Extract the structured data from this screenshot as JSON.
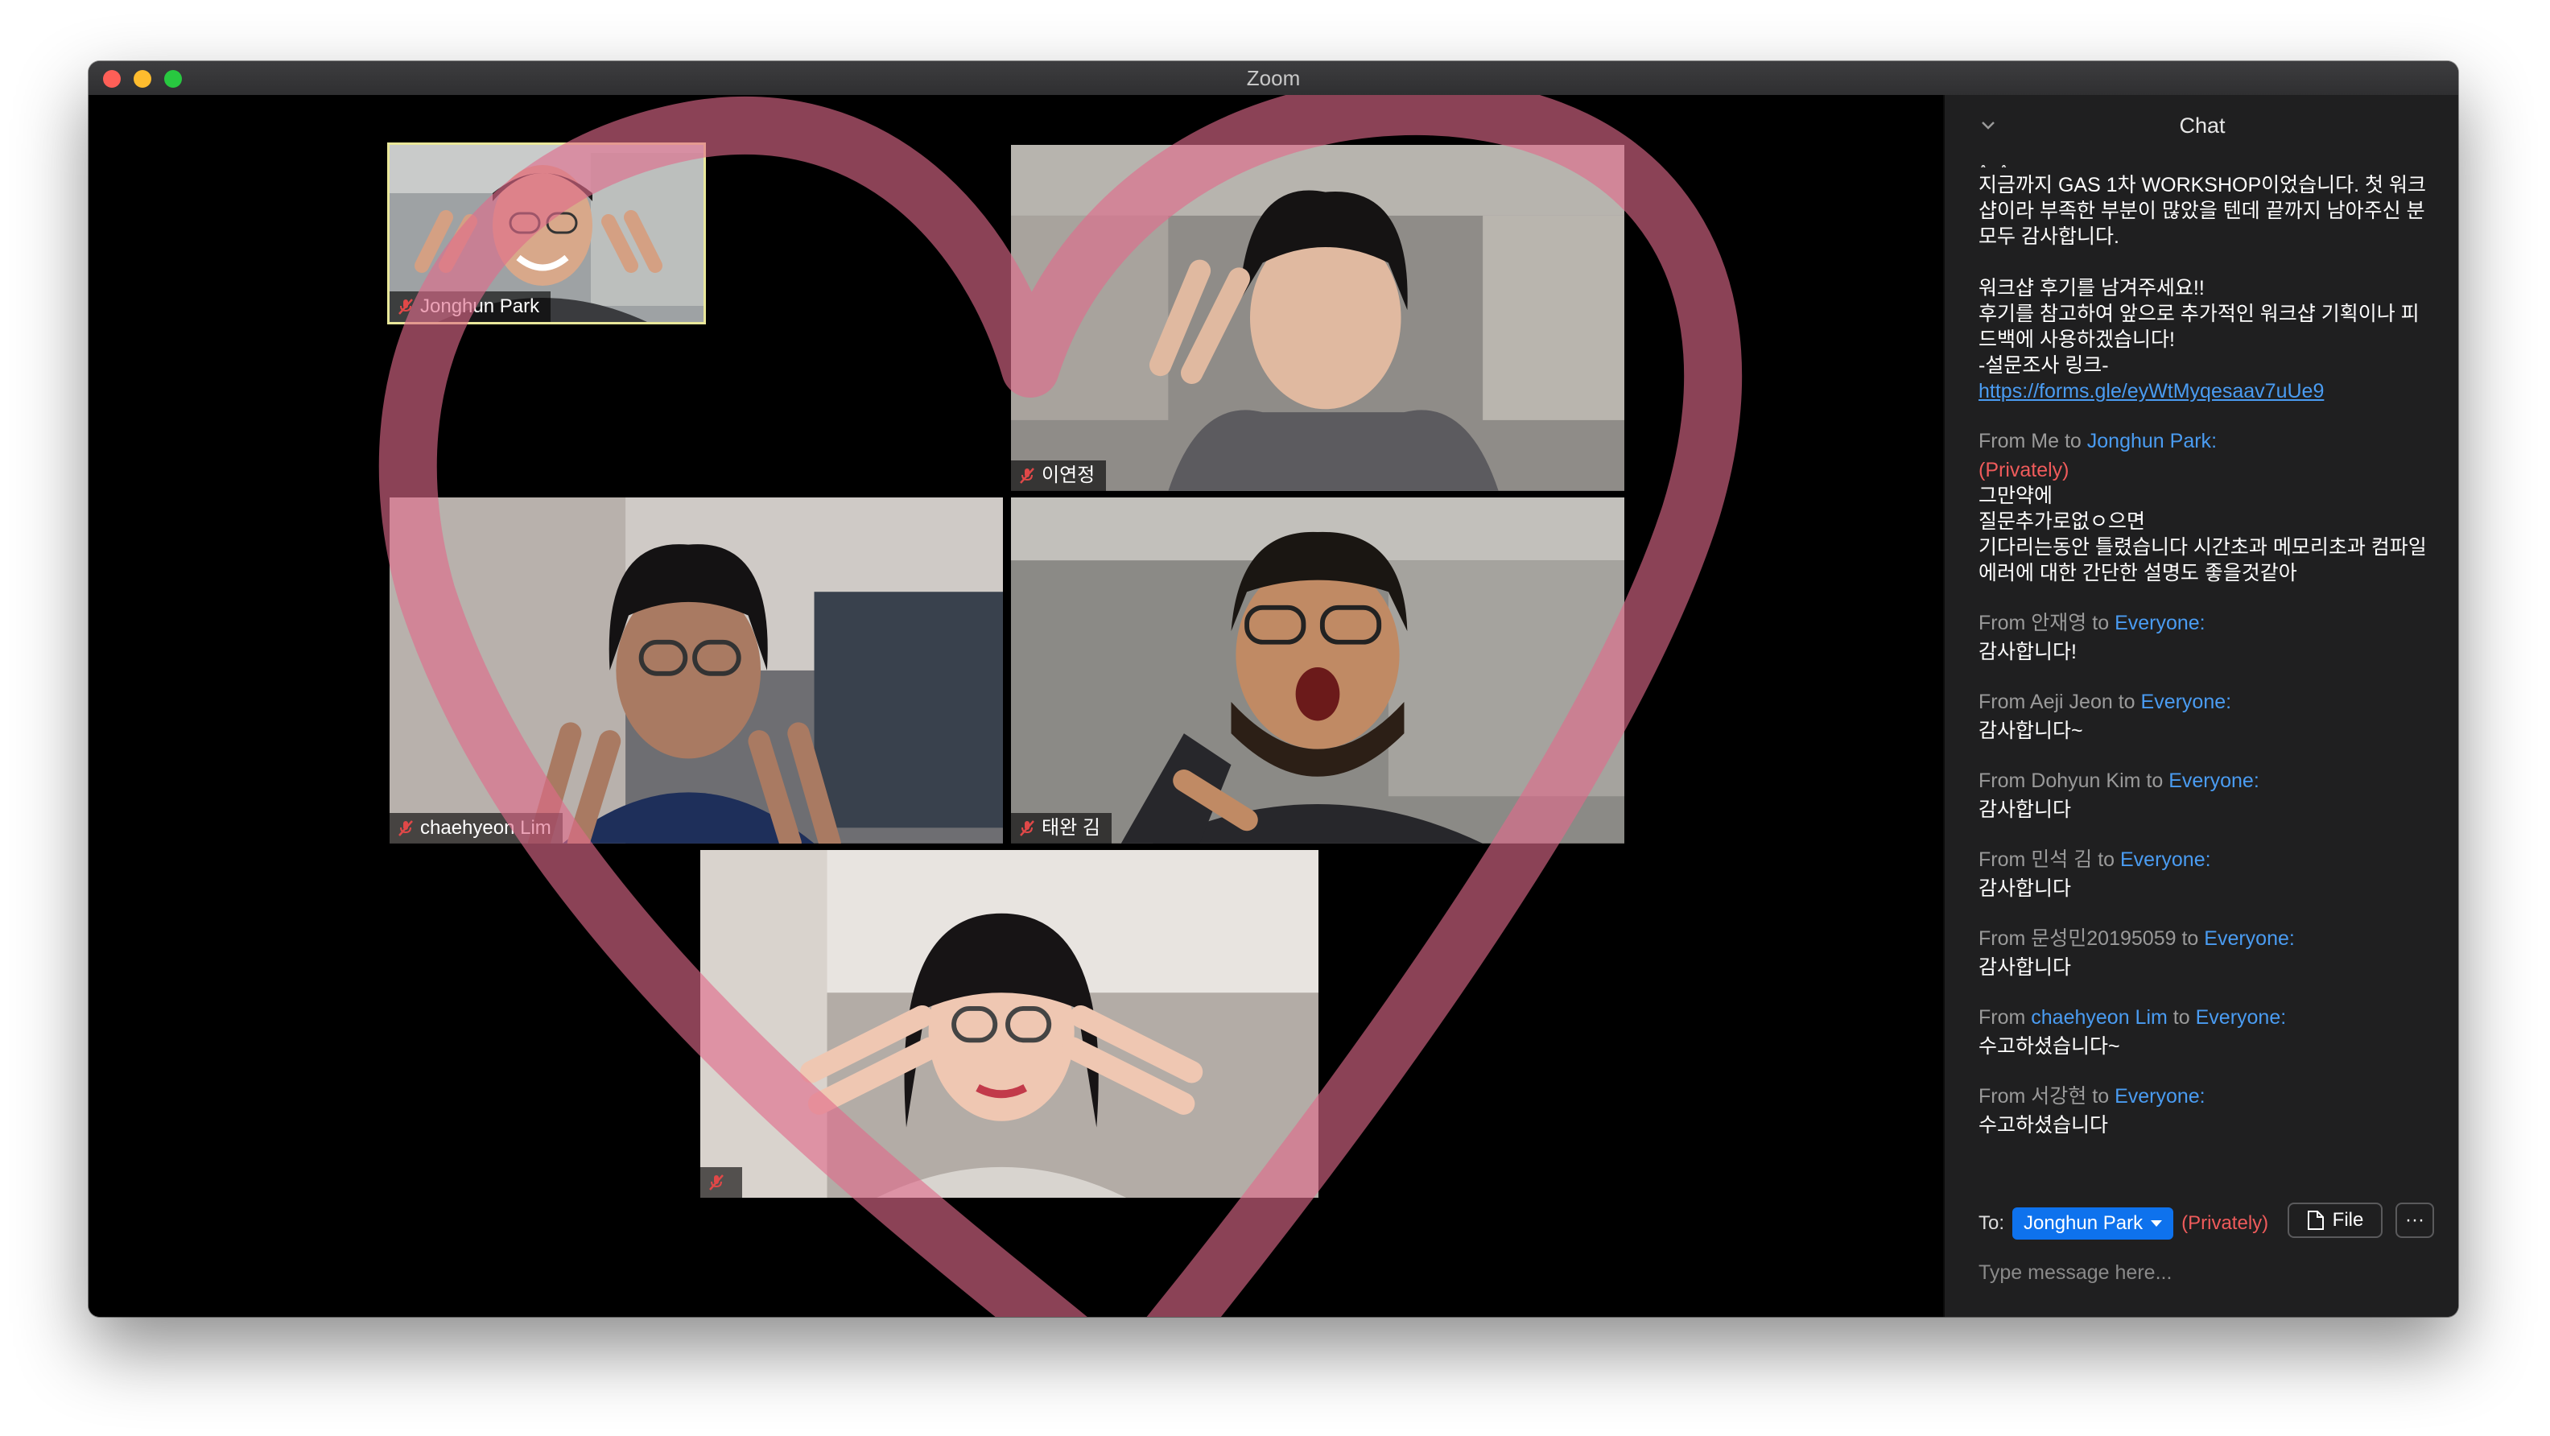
{
  "window": {
    "title": "Zoom"
  },
  "participants": [
    {
      "name": "Jonghun Park",
      "active": true
    },
    {
      "name": "이연정",
      "active": false
    },
    {
      "name": "chaehyeon Lim",
      "active": false
    },
    {
      "name": "태완 김",
      "active": false
    },
    {
      "name": "",
      "active": false
    }
  ],
  "chat": {
    "title": "Chat",
    "truncated_top": "^_^",
    "announcement": {
      "line1": "지금까지 GAS 1차 WORKSHOP이었습니다. 첫 워크샵이라 부족한 부분이 많았을 텐데 끝까지 남아주신 분 모두 감사합니다.",
      "line2": "워크샵 후기를 남겨주세요!!\n후기를 참고하여 앞으로 추가적인 워크샵 기획이나 피드백에 사용하겠습니다!\n-설문조사 링크-",
      "link": "https://forms.gle/eyWtMyqesaav7uUe9"
    },
    "messages": [
      {
        "from": "Me",
        "to": "Jonghun Park",
        "privately": "(Privately)",
        "text": "그만약에\n질문추가로없ㅇ으면\n기다리는동안 틀렸습니다 시간초과 메모리초과 컴파일에러에 대한 간단한 설명도 좋을것같아"
      },
      {
        "from": "안재영",
        "to": "Everyone:",
        "text": "감사합니다!"
      },
      {
        "from": "Aeji Jeon",
        "to": "Everyone:",
        "text": "감사합니다~"
      },
      {
        "from": "Dohyun Kim",
        "to": "Everyone:",
        "text": "감사합니다"
      },
      {
        "from": "민석 김",
        "to": "Everyone:",
        "text": "감사합니다"
      },
      {
        "from": "문성민20195059",
        "to": "Everyone:",
        "text": "감사합니다"
      },
      {
        "from": "chaehyeon Lim",
        "to": "Everyone:",
        "text": "수고하셨습니다~",
        "from_highlight": true
      },
      {
        "from": "서강현",
        "to": "Everyone:",
        "text": "수고하셨습니다"
      }
    ],
    "labels": {
      "from": "From",
      "to": "to",
      "me": "Me"
    },
    "composer": {
      "to_label": "To:",
      "recipient": "Jonghun Park",
      "privately": "(Privately)",
      "file_label": "File",
      "more_label": "···",
      "placeholder": "Type message here..."
    }
  },
  "colors": {
    "accent": "#0e72ed",
    "link": "#4a9cf2",
    "private": "#ef5b5b",
    "active_speaker": "#e9e79a",
    "heart": "#d9476f"
  }
}
